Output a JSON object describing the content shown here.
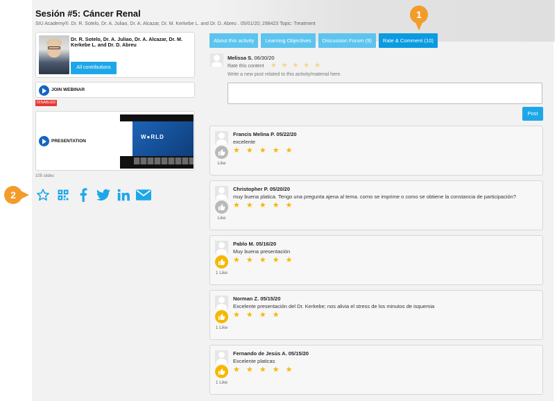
{
  "session": {
    "title": "Sesión #5: Cáncer Renal",
    "subtitle": "SIU Academy®. Dr. R. Sotelo, Dr. A. Juliao, Dr. A. Alcazar, Dr. M. Kerkebe L. and Dr. D. Abreu . 05/01/20; 298423 Topic: Treatment"
  },
  "speaker": {
    "names": "Dr. R. Sotelo, Dr. A. Juliao, Dr. A. Alcazar, Dr. M. Kerkebe L. and Dr. D. Abreu",
    "contributions_label": "All contributions"
  },
  "webinar": {
    "label": "JOIN WEBINAR",
    "status": "DISABLED"
  },
  "presentation": {
    "label": "PRESENTATION",
    "slides_count": "105 slides",
    "thumb_brand": "W●RLD"
  },
  "share_icons": [
    "star-outline-icon",
    "qr-code-icon",
    "facebook-icon",
    "twitter-icon",
    "linkedin-icon",
    "email-icon"
  ],
  "callouts": {
    "one": "1",
    "two": "2"
  },
  "tabs": [
    {
      "label": "About this activity",
      "active": false
    },
    {
      "label": "Learning Objectives",
      "active": false
    },
    {
      "label": "Discussion Forum (9)",
      "active": false
    },
    {
      "label": "Rate & Comment (10)",
      "active": true
    }
  ],
  "compose": {
    "user": "Melissa S.",
    "date": "06/30/20",
    "rate_label": "Rate this content",
    "rate_stars": "★ ★ ★ ★ ★",
    "prompt": "Write a new post related to this activity/material here.",
    "post_label": "Post"
  },
  "comments": [
    {
      "author": "Francis Melina P.",
      "date": "05/22/20",
      "text": "excelente",
      "stars": "★ ★ ★ ★ ★",
      "likes": "Like",
      "liked": false
    },
    {
      "author": "Christopher P.",
      "date": "05/20/20",
      "text": "muy buena platica. Tengo una pregunta ajena al tema. como se imprime o como se obtiene la constancia de participación?",
      "stars": "★ ★ ★ ★ ★",
      "likes": "Like",
      "liked": false
    },
    {
      "author": "Pablo M.",
      "date": "05/16/20",
      "text": "Muy buena presentación",
      "stars": "★ ★ ★ ★ ★",
      "likes": "1 Like",
      "liked": true
    },
    {
      "author": "Norman Z.",
      "date": "05/15/20",
      "text": "Excelente presentación del Dr. Kerkebe; nos alivia el stress de los minutos de isquemia",
      "stars": "★ ★ ★ ★",
      "likes": "1 Like",
      "liked": true
    },
    {
      "author": "Fernando de Jesús A.",
      "date": "05/15/20",
      "text": "Excelente platicas",
      "stars": "★ ★ ★ ★ ★",
      "likes": "1 Like",
      "liked": true
    }
  ],
  "colors": {
    "accent": "#1ea7e8",
    "tab": "#5cc4ee",
    "tab_active": "#0b9be0",
    "star": "#f5b800",
    "callout": "#f39c2b",
    "disabled": "#e53935"
  }
}
